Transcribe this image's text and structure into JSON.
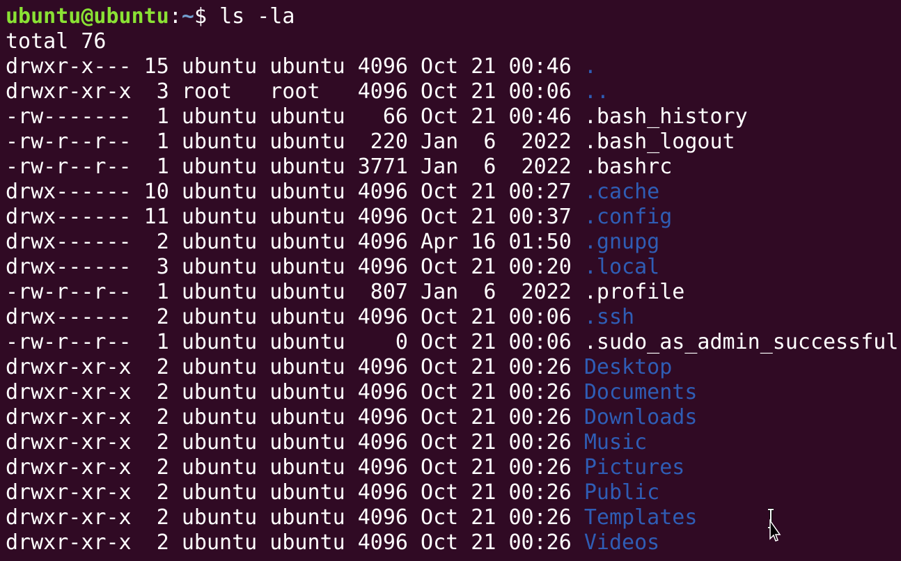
{
  "terminal": {
    "prompt": {
      "user_host": "ubuntu@ubuntu",
      "separator": ":",
      "path": "~",
      "dollar": "$ ",
      "command": "ls -la"
    },
    "total": "total 76",
    "entries": [
      {
        "meta": "drwxr-x--- 15 ubuntu ubuntu 4096 Oct 21 00:46 ",
        "name": ".",
        "type": "dir"
      },
      {
        "meta": "drwxr-xr-x  3 root   root   4096 Oct 21 00:06 ",
        "name": "..",
        "type": "dir"
      },
      {
        "meta": "-rw-------  1 ubuntu ubuntu   66 Oct 21 00:46 ",
        "name": ".bash_history",
        "type": "file"
      },
      {
        "meta": "-rw-r--r--  1 ubuntu ubuntu  220 Jan  6  2022 ",
        "name": ".bash_logout",
        "type": "file"
      },
      {
        "meta": "-rw-r--r--  1 ubuntu ubuntu 3771 Jan  6  2022 ",
        "name": ".bashrc",
        "type": "file"
      },
      {
        "meta": "drwx------ 10 ubuntu ubuntu 4096 Oct 21 00:27 ",
        "name": ".cache",
        "type": "dir"
      },
      {
        "meta": "drwx------ 11 ubuntu ubuntu 4096 Oct 21 00:37 ",
        "name": ".config",
        "type": "dir"
      },
      {
        "meta": "drwx------  2 ubuntu ubuntu 4096 Apr 16 01:50 ",
        "name": ".gnupg",
        "type": "dir"
      },
      {
        "meta": "drwx------  3 ubuntu ubuntu 4096 Oct 21 00:20 ",
        "name": ".local",
        "type": "dir"
      },
      {
        "meta": "-rw-r--r--  1 ubuntu ubuntu  807 Jan  6  2022 ",
        "name": ".profile",
        "type": "file"
      },
      {
        "meta": "drwx------  2 ubuntu ubuntu 4096 Oct 21 00:06 ",
        "name": ".ssh",
        "type": "dir"
      },
      {
        "meta": "-rw-r--r--  1 ubuntu ubuntu    0 Oct 21 00:06 ",
        "name": ".sudo_as_admin_successful",
        "type": "file"
      },
      {
        "meta": "drwxr-xr-x  2 ubuntu ubuntu 4096 Oct 21 00:26 ",
        "name": "Desktop",
        "type": "dir"
      },
      {
        "meta": "drwxr-xr-x  2 ubuntu ubuntu 4096 Oct 21 00:26 ",
        "name": "Documents",
        "type": "dir"
      },
      {
        "meta": "drwxr-xr-x  2 ubuntu ubuntu 4096 Oct 21 00:26 ",
        "name": "Downloads",
        "type": "dir"
      },
      {
        "meta": "drwxr-xr-x  2 ubuntu ubuntu 4096 Oct 21 00:26 ",
        "name": "Music",
        "type": "dir"
      },
      {
        "meta": "drwxr-xr-x  2 ubuntu ubuntu 4096 Oct 21 00:26 ",
        "name": "Pictures",
        "type": "dir"
      },
      {
        "meta": "drwxr-xr-x  2 ubuntu ubuntu 4096 Oct 21 00:26 ",
        "name": "Public",
        "type": "dir"
      },
      {
        "meta": "drwxr-xr-x  2 ubuntu ubuntu 4096 Oct 21 00:26 ",
        "name": "Templates",
        "type": "dir"
      },
      {
        "meta": "drwxr-xr-x  2 ubuntu ubuntu 4096 Oct 21 00:26 ",
        "name": "Videos",
        "type": "dir"
      }
    ],
    "mouse_cursor_icon": "i-beam-arrow-cursor-icon"
  },
  "colors": {
    "background": "#300a24",
    "prompt_user": "#8ae234",
    "prompt_path": "#729fcf",
    "directory": "#2f5db5",
    "text": "#ffffff"
  }
}
